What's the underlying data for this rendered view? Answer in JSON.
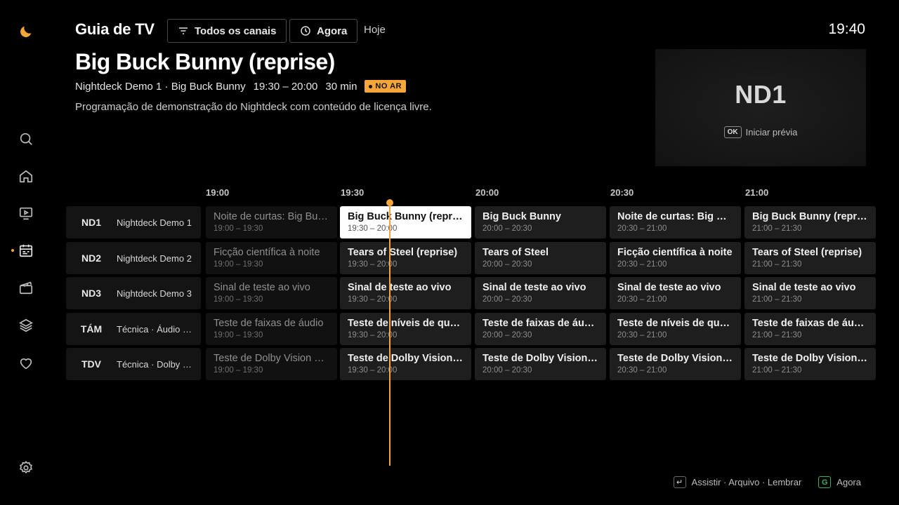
{
  "header": {
    "app_title": "Guia de TV",
    "filter_label": "Todos os canais",
    "now_label": "Agora",
    "today_label": "Hoje",
    "clock": "19:40"
  },
  "program": {
    "title": "Big Buck Bunny (reprise)",
    "channel": "Nightdeck Demo 1 · Big Buck Bunny",
    "time": "19:30 – 20:00",
    "duration": "30 min",
    "badge": "NO AR",
    "description": "Programação de demonstração do Nightdeck com conteúdo de licença livre."
  },
  "preview": {
    "logo": "ND1",
    "key": "OK",
    "hint": "Iniciar prévia"
  },
  "timeline": {
    "times": [
      "19:00",
      "19:30",
      "20:00",
      "20:30",
      "21:00"
    ]
  },
  "guide": [
    {
      "num": "ND1",
      "name": "Nightdeck Demo 1",
      "programs": [
        {
          "title": "Noite de curtas: Big Buck Bunny",
          "time": "19:00 – 19:30"
        },
        {
          "title": "Big Buck Bunny (reprise)",
          "time": "19:30 – 20:00"
        },
        {
          "title": "Big Buck Bunny",
          "time": "20:00 – 20:30"
        },
        {
          "title": "Noite de curtas: Big Buck Bunny",
          "time": "20:30 – 21:00"
        },
        {
          "title": "Big Buck Bunny (reprise)",
          "time": "21:00 – 21:30"
        }
      ]
    },
    {
      "num": "ND2",
      "name": "Nightdeck Demo 2",
      "programs": [
        {
          "title": "Ficção científica à noite",
          "time": "19:00 – 19:30"
        },
        {
          "title": "Tears of Steel (reprise)",
          "time": "19:30 – 20:00"
        },
        {
          "title": "Tears of Steel",
          "time": "20:00 – 20:30"
        },
        {
          "title": "Ficção científica à noite",
          "time": "20:30 – 21:00"
        },
        {
          "title": "Tears of Steel (reprise)",
          "time": "21:00 – 21:30"
        }
      ]
    },
    {
      "num": "ND3",
      "name": "Nightdeck Demo 3",
      "programs": [
        {
          "title": "Sinal de teste ao vivo",
          "time": "19:00 – 19:30"
        },
        {
          "title": "Sinal de teste ao vivo",
          "time": "19:30 – 20:00"
        },
        {
          "title": "Sinal de teste ao vivo",
          "time": "20:00 – 20:30"
        },
        {
          "title": "Sinal de teste ao vivo",
          "time": "20:30 – 21:00"
        },
        {
          "title": "Sinal de teste ao vivo",
          "time": "21:00 – 21:30"
        }
      ]
    },
    {
      "num": "TÁM",
      "name": "Técnica · Áudio Multicanal",
      "programs": [
        {
          "title": "Teste de faixas de áudio",
          "time": "19:00 – 19:30"
        },
        {
          "title": "Teste de níveis de qualidade",
          "time": "19:30 – 20:00"
        },
        {
          "title": "Teste de faixas de áudio",
          "time": "20:00 – 20:30"
        },
        {
          "title": "Teste de níveis de qualidade",
          "time": "20:30 – 21:00"
        },
        {
          "title": "Teste de faixas de áudio",
          "time": "21:00 – 21:30"
        }
      ]
    },
    {
      "num": "TDV",
      "name": "Técnica · Dolby Vision",
      "programs": [
        {
          "title": "Teste de Dolby Vision e HDR",
          "time": "19:00 – 19:30"
        },
        {
          "title": "Teste de Dolby Vision e HDR",
          "time": "19:30 – 20:00"
        },
        {
          "title": "Teste de Dolby Vision e HDR",
          "time": "20:00 – 20:30"
        },
        {
          "title": "Teste de Dolby Vision e HDR",
          "time": "20:30 – 21:00"
        },
        {
          "title": "Teste de Dolby Vision e HDR",
          "time": "21:00 – 21:30"
        }
      ]
    }
  ],
  "footer": {
    "enter_key": "↵",
    "actions": "Assistir · Arquivo · Lembrar",
    "g_key": "G",
    "g_label": "Agora"
  },
  "colors": {
    "accent": "#f5a53a",
    "background": "#000000",
    "focus": "#ffffff",
    "green_key": "#3fae5b"
  },
  "sidebar": {
    "items": [
      "logo-moon-icon",
      "search-icon",
      "home-icon",
      "tv-icon",
      "guide-icon",
      "movies-icon",
      "library-icon",
      "favorites-icon",
      "settings-icon"
    ]
  }
}
